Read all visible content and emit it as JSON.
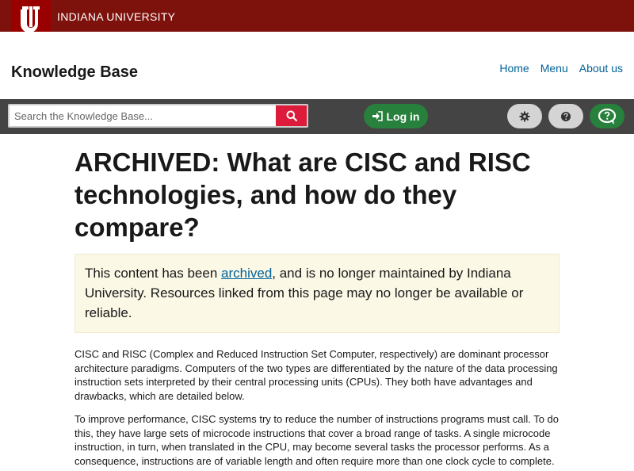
{
  "brand": {
    "university": "INDIANA UNIVERSITY",
    "site_title": "Knowledge Base",
    "banner_color": "#7d110c",
    "logo_color": "#990000"
  },
  "nav": {
    "items": [
      {
        "label": "Home"
      },
      {
        "label": "Menu"
      },
      {
        "label": "About us"
      }
    ]
  },
  "toolbar": {
    "search_placeholder": "Search the Knowledge Base...",
    "login_label": "Log in",
    "icons": [
      "search-icon",
      "login-icon",
      "gear-icon",
      "question-icon",
      "chat-question-icon"
    ]
  },
  "article": {
    "title": "ARCHIVED: What are CISC and RISC technologies, and how do they compare?",
    "notice_before": "This content has been ",
    "notice_link": "archived",
    "notice_after": ", and is no longer maintained by Indiana University. Resources linked from this page may no longer be available or reliable.",
    "paragraphs": [
      "CISC and RISC (Complex and Reduced Instruction Set Computer, respectively) are dominant processor architecture paradigms. Computers of the two types are differentiated by the nature of the data processing instruction sets interpreted by their central processing units (CPUs). They both have advantages and drawbacks, which are detailed below.",
      "To improve performance, CISC systems try to reduce the number of instructions programs must call. To do this, they have large sets of microcode instructions that cover a broad range of tasks. A single microcode instruction, in turn, when translated in the CPU, may become several tasks the processor performs. As a consequence, instructions are of variable length and often require more than one clock cycle to complete."
    ]
  }
}
